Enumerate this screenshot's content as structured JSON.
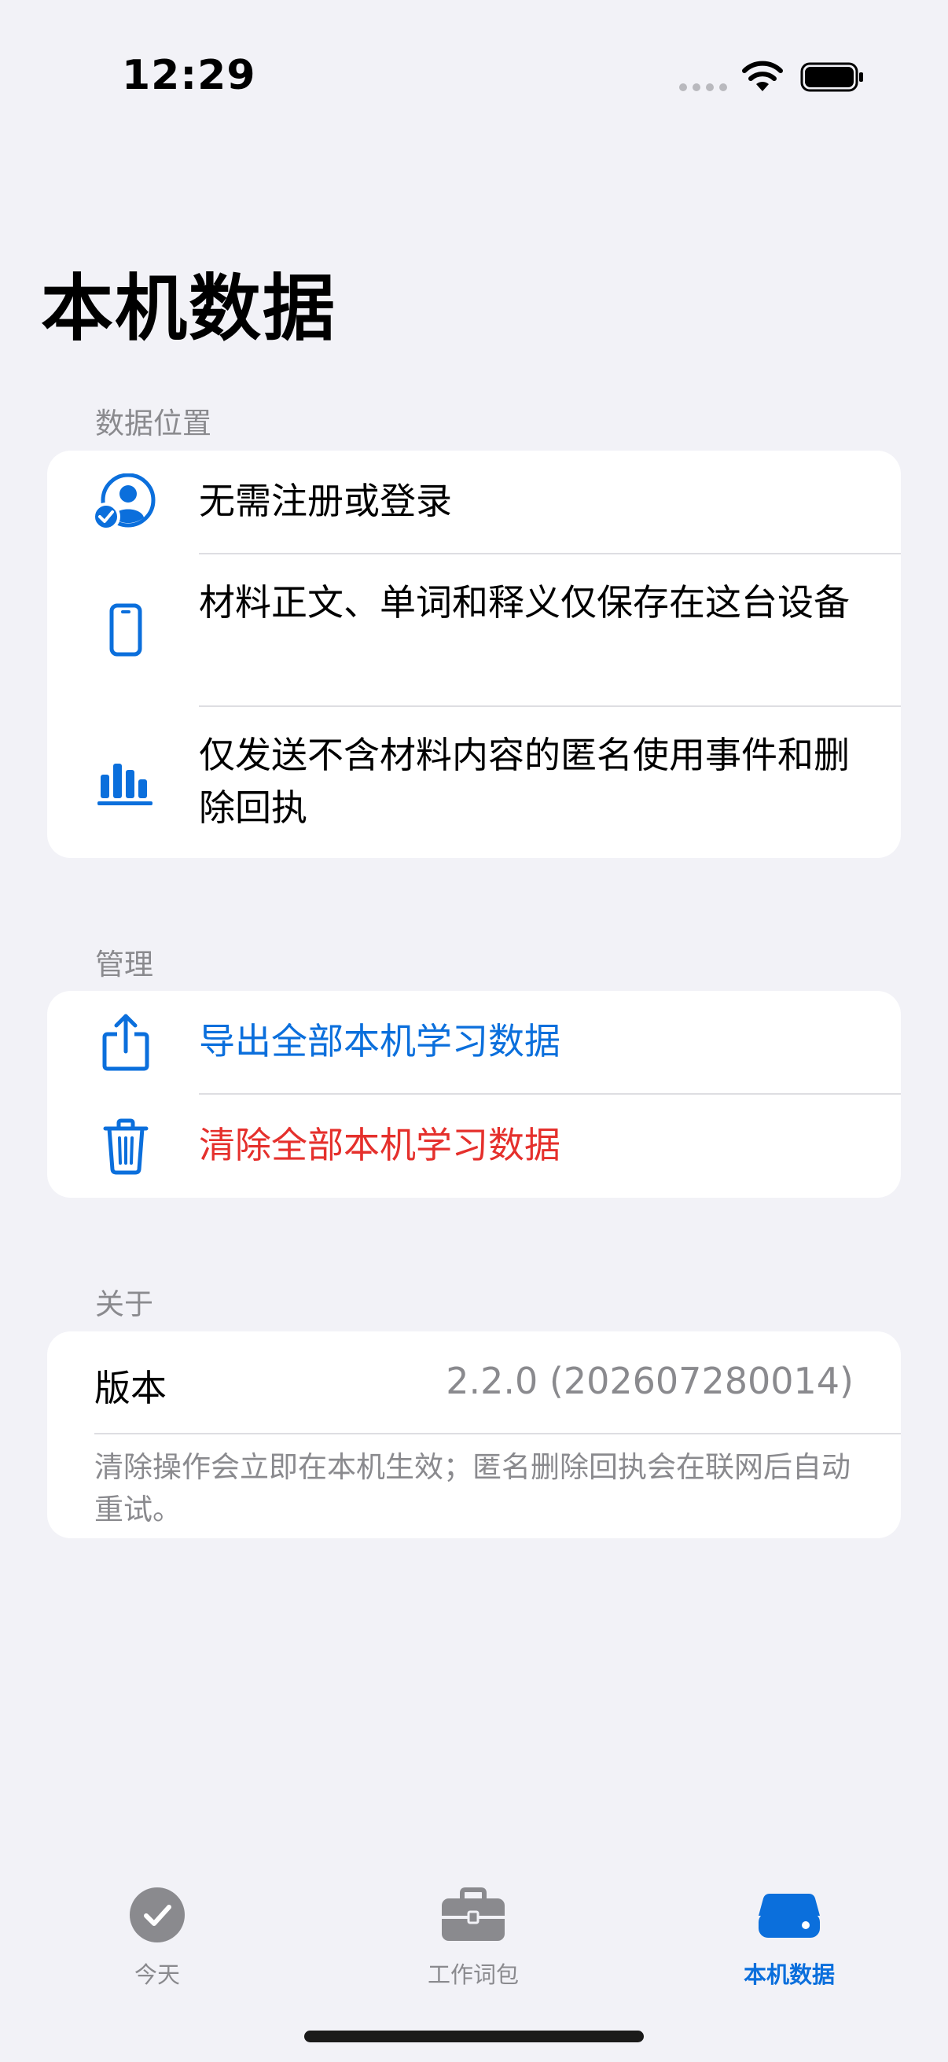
{
  "status_bar": {
    "time": "12:29"
  },
  "page": {
    "title": "本机数据"
  },
  "sections": {
    "data_location": {
      "header": "数据位置",
      "rows": [
        {
          "text": "无需注册或登录",
          "icon": "person-badge-check-icon"
        },
        {
          "text": "材料正文、单词和释义仅保存在这台设备",
          "icon": "iphone-icon"
        },
        {
          "text": "仅发送不含材料内容的匿名使用事件和删除回执",
          "icon": "bar-chart-icon"
        }
      ]
    },
    "manage": {
      "header": "管理",
      "export_label": "导出全部本机学习数据",
      "clear_label": "清除全部本机学习数据"
    },
    "about": {
      "header": "关于",
      "version_label": "版本",
      "version_value": "2.2.0 (202607280014)",
      "footnote": "清除操作会立即在本机生效；匿名删除回执会在联网后自动重试。"
    }
  },
  "tab_bar": {
    "tabs": [
      {
        "label": "今天",
        "icon": "checkmark-circle-icon",
        "active": false
      },
      {
        "label": "工作词包",
        "icon": "briefcase-icon",
        "active": false
      },
      {
        "label": "本机数据",
        "icon": "internal-drive-icon",
        "active": true
      }
    ]
  },
  "colors": {
    "accent": "#0b6fdc",
    "destructive": "#e5302c",
    "background": "#f2f2f7",
    "secondary_text": "#8a8a8e"
  }
}
